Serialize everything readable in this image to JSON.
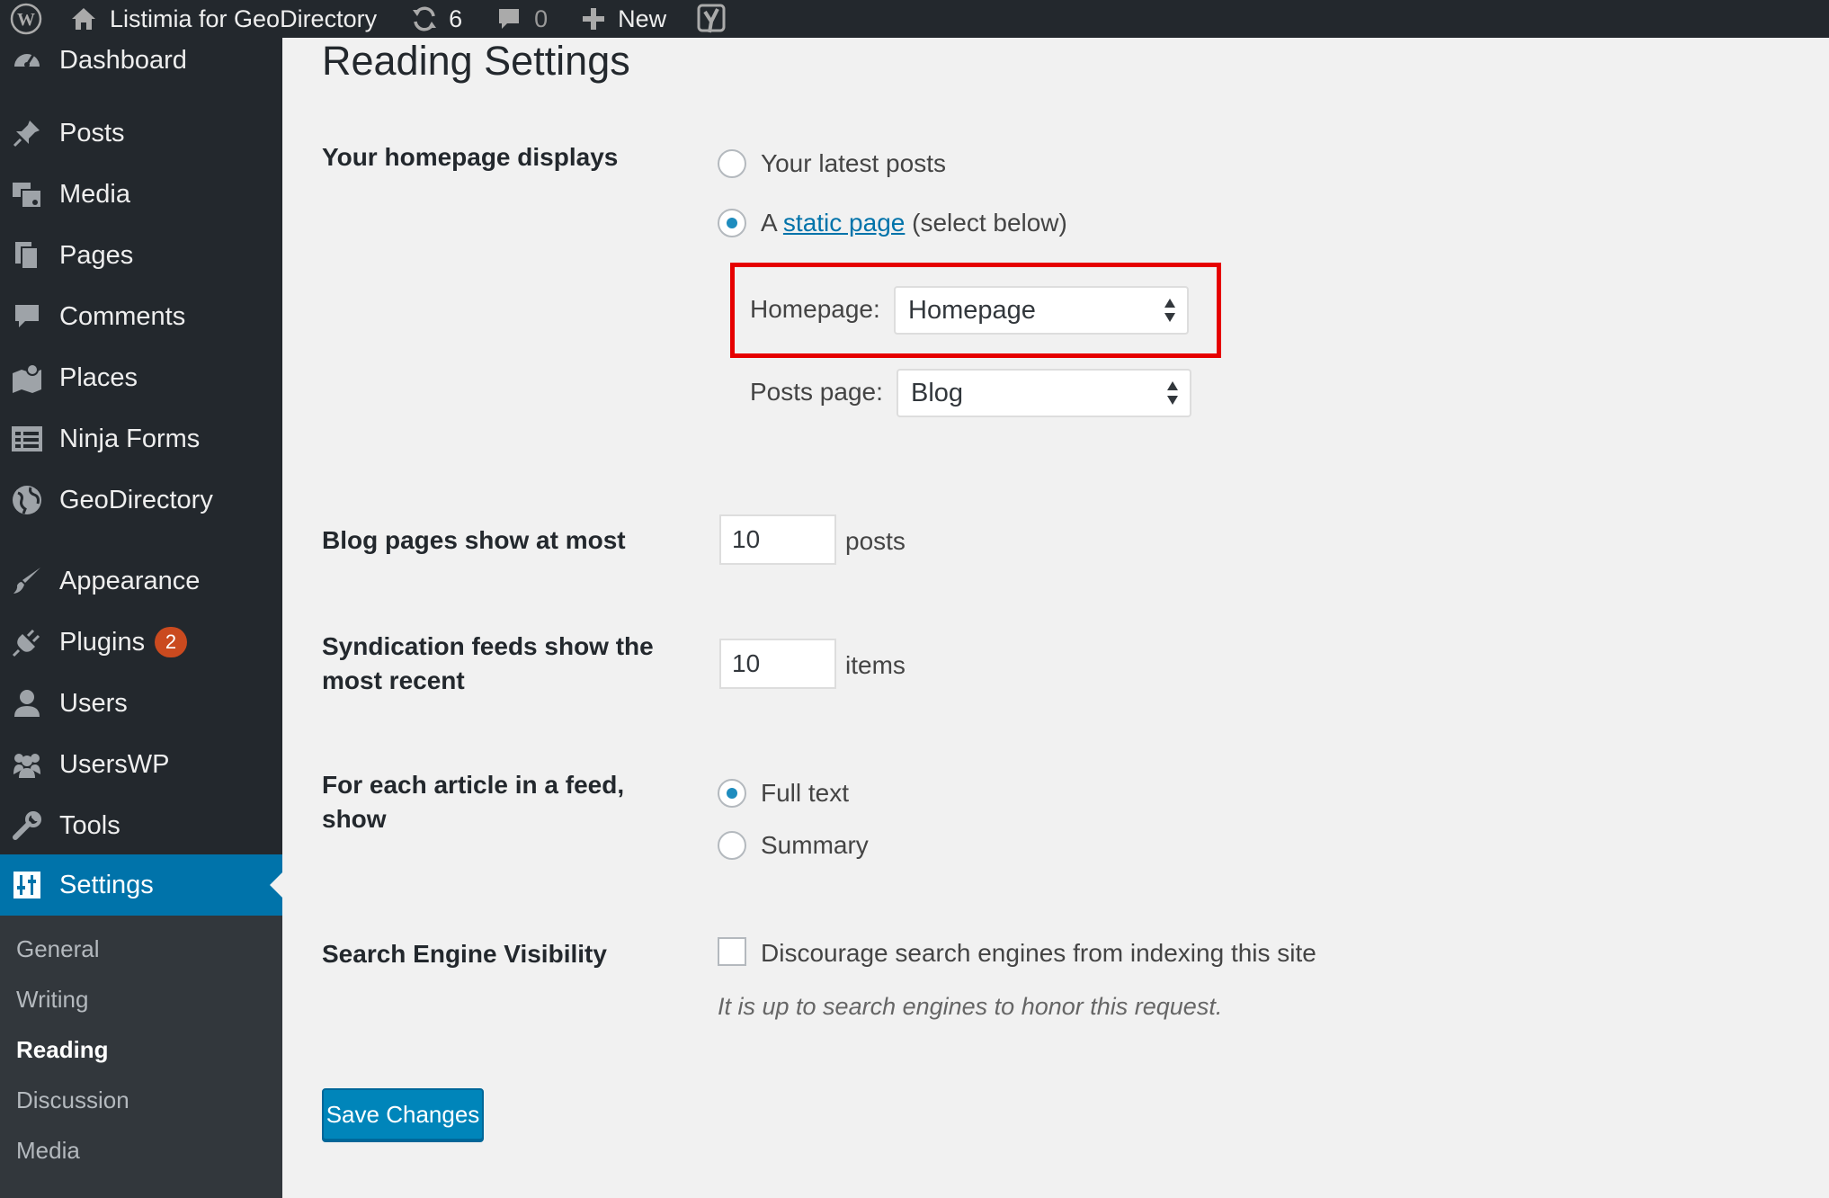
{
  "adminbar": {
    "site_name": "Listimia for GeoDirectory",
    "updates_count": "6",
    "comments_count": "0",
    "new_label": "New"
  },
  "sidebar": {
    "items": [
      {
        "label": "Dashboard",
        "icon": "dashboard-icon"
      },
      {
        "label": "Posts",
        "icon": "pin-icon"
      },
      {
        "label": "Media",
        "icon": "media-icon"
      },
      {
        "label": "Pages",
        "icon": "pages-icon"
      },
      {
        "label": "Comments",
        "icon": "comment-icon"
      },
      {
        "label": "Places",
        "icon": "map-icon"
      },
      {
        "label": "Ninja Forms",
        "icon": "forms-icon"
      },
      {
        "label": "GeoDirectory",
        "icon": "globe-icon"
      },
      {
        "label": "Appearance",
        "icon": "brush-icon"
      },
      {
        "label": "Plugins",
        "icon": "plugin-icon",
        "badge": "2"
      },
      {
        "label": "Users",
        "icon": "user-icon"
      },
      {
        "label": "UsersWP",
        "icon": "users-group-icon"
      },
      {
        "label": "Tools",
        "icon": "wrench-icon"
      },
      {
        "label": "Settings",
        "icon": "settings-icon",
        "current": true
      }
    ],
    "submenu": [
      "General",
      "Writing",
      "Reading",
      "Discussion",
      "Media"
    ],
    "current_submenu": "Reading"
  },
  "main": {
    "title": "Reading Settings",
    "homepage_displays": {
      "label": "Your homepage displays",
      "option_latest": "Your latest posts",
      "option_static_prefix": "A",
      "option_static_link": "static page",
      "option_static_suffix": "(select below)",
      "selected": "static"
    },
    "homepage_select": {
      "label": "Homepage:",
      "value": "Homepage"
    },
    "posts_page_select": {
      "label": "Posts page:",
      "value": "Blog"
    },
    "blog_pages": {
      "label": "Blog pages show at most",
      "value": "10",
      "suffix": "posts"
    },
    "syndication": {
      "label": "Syndication feeds show the most recent",
      "value": "10",
      "suffix": "items"
    },
    "feed_article": {
      "label": "For each article in a feed, show",
      "option_full": "Full text",
      "option_summary": "Summary",
      "selected": "full"
    },
    "search_visibility": {
      "label": "Search Engine Visibility",
      "checkbox_label": "Discourage search engines from indexing this site",
      "checked": false,
      "description": "It is up to search engines to honor this request."
    },
    "save_label": "Save Changes"
  },
  "colors": {
    "admin_dark": "#23282d",
    "submenu_bg": "#32373c",
    "accent_blue": "#0073aa",
    "button_blue": "#0085ba",
    "highlight_red": "#e60000",
    "badge_orange": "#ca4a1f"
  }
}
